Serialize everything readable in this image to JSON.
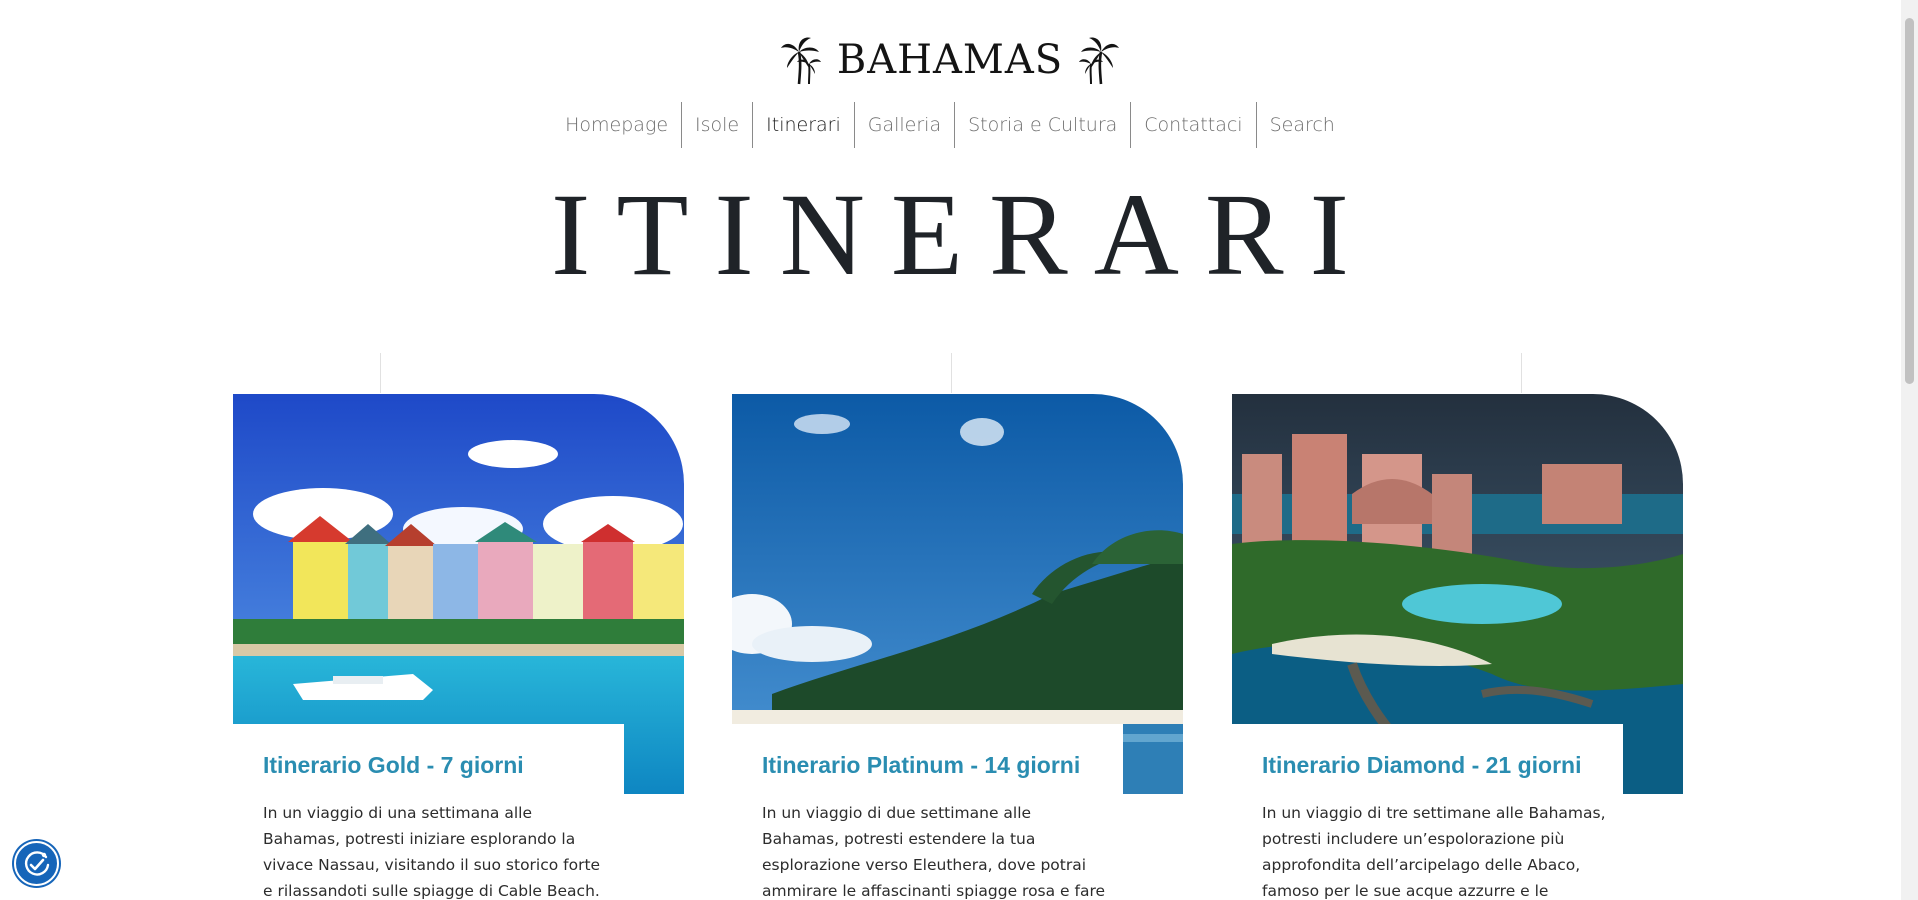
{
  "brand": {
    "name": "BAHAMAS",
    "icon": "palm-tree-icon"
  },
  "nav": {
    "items": [
      {
        "label": "Homepage",
        "active": false
      },
      {
        "label": "Isole",
        "active": false
      },
      {
        "label": "Itinerari",
        "active": true
      },
      {
        "label": "Galleria",
        "active": false
      },
      {
        "label": "Storia e Cultura",
        "active": false
      },
      {
        "label": "Contattaci",
        "active": false
      },
      {
        "label": "Search",
        "active": false
      }
    ]
  },
  "page": {
    "title": "ITINERARI"
  },
  "cards": [
    {
      "title": "Itinerario Gold - 7 giorni",
      "text": "In un viaggio di una settimana alle Bahamas, potresti iniziare esplorando la vivace Nassau, visitando il suo storico forte e rilassandoti sulle spiagge di Cable Beach. Successivamente,",
      "image": "colorful-harbour-houses-and-yacht"
    },
    {
      "title": "Itinerario Platinum - 14 giorni",
      "text": "In un viaggio di due settimane alle Bahamas, potresti estendere la tua esplorazione verso Eleuthera, dove potrai ammirare le affascinanti spiagge rosa e fare un tuffo nelle acque",
      "image": "palm-trees-beach-under-blue-sky"
    },
    {
      "title": "Itinerario Diamond - 21 giorni",
      "text": "In un viaggio di tre settimane alle Bahamas, potresti includere un’espolorazione più approfondita dell’arcipelago delle Abaco, famoso per le sue acque azzurre e le spiagge",
      "image": "aerial-resort-with-lagoon"
    }
  ],
  "accessibility": {
    "icon": "accessibility-icon"
  },
  "colors": {
    "card_title": "#2a8db1",
    "accent_badge": "#1665b9",
    "text": "#2c2c2c"
  }
}
